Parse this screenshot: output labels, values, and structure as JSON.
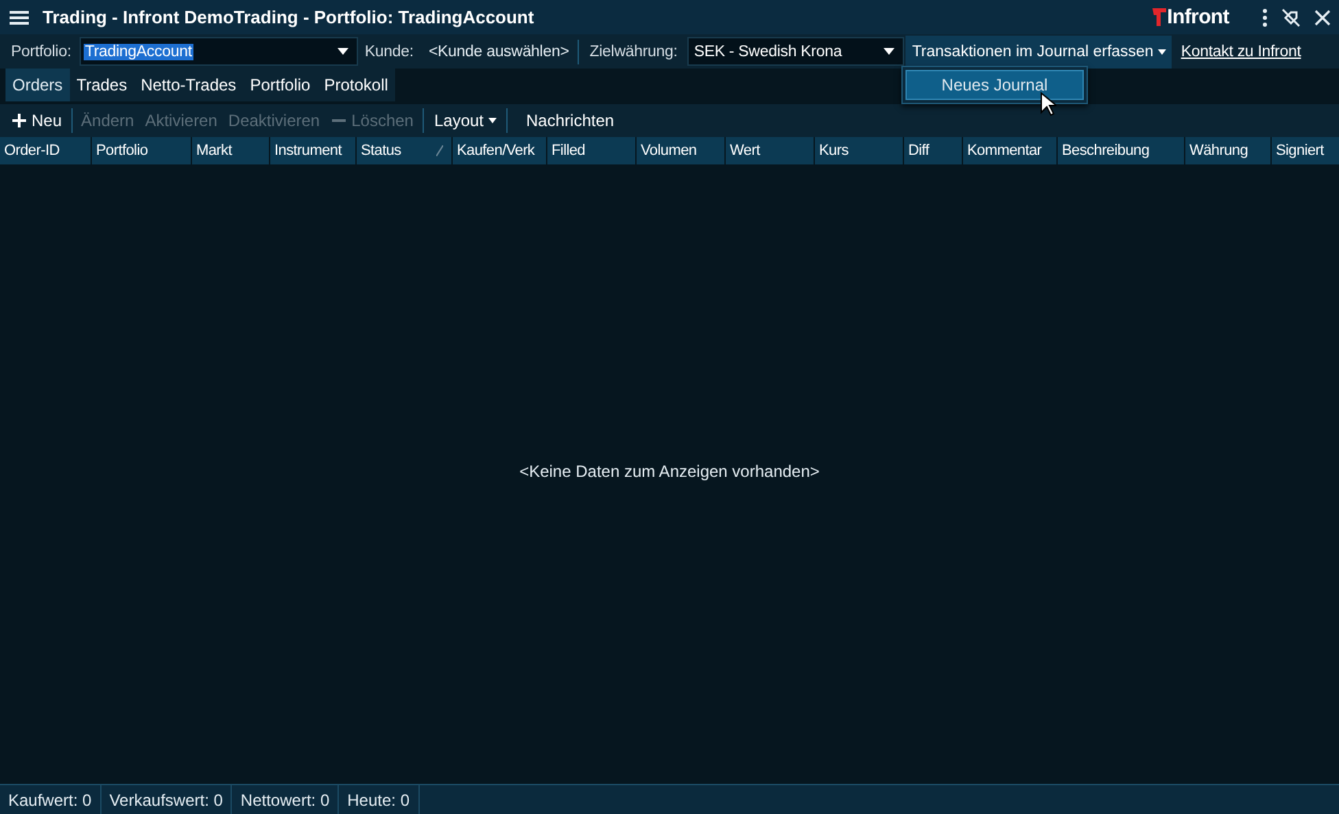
{
  "window": {
    "title": "Trading - Infront DemoTrading - Portfolio: TradingAccount",
    "logo": "Infront"
  },
  "filter_bar": {
    "portfolio_label": "Portfolio:",
    "portfolio_value": "TradingAccount",
    "portfolio_value_selected": true,
    "customer_label": "Kunde:",
    "customer_value": "<Kunde auswählen>",
    "currency_label": "Zielwährung:",
    "currency_value": "SEK - Swedish Krona",
    "journal_button": "Transaktionen im Journal erfassen",
    "contact_link": "Kontakt zu Infront"
  },
  "journal_menu": {
    "items": [
      {
        "label": "Neues Journal",
        "selected": true
      }
    ]
  },
  "tabs": [
    {
      "label": "Orders",
      "selected": true
    },
    {
      "label": "Trades",
      "selected": false
    },
    {
      "label": "Netto-Trades",
      "selected": false
    },
    {
      "label": "Portfolio",
      "selected": false
    },
    {
      "label": "Protokoll",
      "selected": false
    }
  ],
  "toolbar": [
    {
      "kind": "plus",
      "label": "Neu",
      "disabled": false
    },
    {
      "kind": "separator"
    },
    {
      "kind": "plain",
      "label": "Ändern",
      "disabled": true
    },
    {
      "kind": "plain",
      "label": "Aktivieren",
      "disabled": true
    },
    {
      "kind": "plain",
      "label": "Deaktivieren",
      "disabled": true
    },
    {
      "kind": "minus",
      "label": "Löschen",
      "disabled": true
    },
    {
      "kind": "separator"
    },
    {
      "kind": "dropdown",
      "label": "Layout",
      "disabled": false
    },
    {
      "kind": "separator"
    },
    {
      "kind": "plain",
      "label": "Nachrichten",
      "disabled": false
    }
  ],
  "table": {
    "columns": [
      {
        "label": "Order-ID",
        "sorted": false
      },
      {
        "label": "Portfolio",
        "sorted": false
      },
      {
        "label": "Markt",
        "sorted": false
      },
      {
        "label": "Instrument",
        "sorted": false
      },
      {
        "label": "Status",
        "sorted": true
      },
      {
        "label": "Kaufen/Verk",
        "sorted": false
      },
      {
        "label": "Filled",
        "sorted": false
      },
      {
        "label": "Volumen",
        "sorted": false
      },
      {
        "label": "Wert",
        "sorted": false
      },
      {
        "label": "Kurs",
        "sorted": false
      },
      {
        "label": "Diff",
        "sorted": false
      },
      {
        "label": "Kommentar",
        "sorted": false
      },
      {
        "label": "Beschreibung",
        "sorted": false
      },
      {
        "label": "Währung",
        "sorted": false
      },
      {
        "label": "Signiert",
        "sorted": false
      }
    ],
    "empty_message": "<Keine Daten zum Anzeigen vorhanden>"
  },
  "status_bar": [
    "Kaufwert: 0",
    "Verkaufswert: 0",
    "Nettowert: 0",
    "Heute: 0"
  ]
}
